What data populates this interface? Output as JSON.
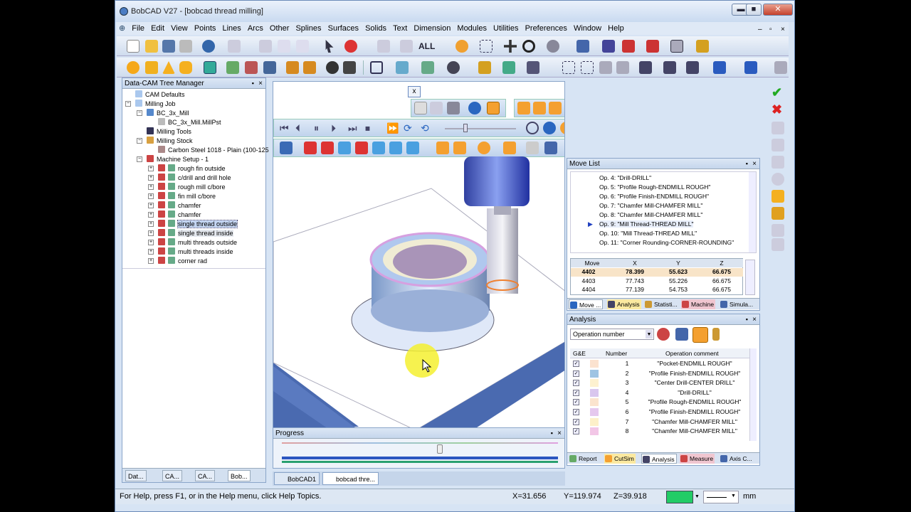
{
  "window": {
    "title": "BobCAD V27 - [bobcad thread milling]",
    "min": "▬",
    "max": "■",
    "close": "✕"
  },
  "menu": {
    "items": [
      "File",
      "Edit",
      "View",
      "Points",
      "Lines",
      "Arcs",
      "Other",
      "Splines",
      "Surfaces",
      "Solids",
      "Text",
      "Dimension",
      "Modules",
      "Utilities",
      "Preferences",
      "Window",
      "Help"
    ],
    "mdi_min": "–",
    "mdi_max": "▫",
    "mdi_close": "×"
  },
  "toolbar": {
    "all_label": "ALL"
  },
  "tree": {
    "title": "Data-CAM Tree Manager",
    "pin": "▪",
    "close": "×",
    "nodes": [
      {
        "label": "CAM Defaults"
      },
      {
        "label": "Milling Job"
      },
      {
        "label": "BC_3x_Mill"
      },
      {
        "label": "BC_3x_Mill.MillPst"
      },
      {
        "label": "Milling Tools"
      },
      {
        "label": "Milling Stock"
      },
      {
        "label": "Carbon Steel 1018 - Plain (100-125"
      },
      {
        "label": "Machine Setup - 1"
      },
      {
        "label": "rough fin outside"
      },
      {
        "label": "c/drill and drill hole"
      },
      {
        "label": "rough mill c/bore"
      },
      {
        "label": "fin mill c/bore"
      },
      {
        "label": "chamfer"
      },
      {
        "label": "chamfer"
      },
      {
        "label": "single thread outside"
      },
      {
        "label": "single thread  inside"
      },
      {
        "label": "multi threads outside"
      },
      {
        "label": "multi threads inside"
      },
      {
        "label": "corner rad"
      }
    ],
    "tabs": [
      "Dat...",
      "CA...",
      "CA...",
      "Bob..."
    ]
  },
  "viewport": {
    "close": "x"
  },
  "progress": {
    "title": "Progress"
  },
  "doctabs": [
    "BobCAD1",
    "bobcad thre..."
  ],
  "movelist": {
    "title": "Move List",
    "ops": [
      "Op. 4: \"Drill-DRILL\"",
      "Op. 5: \"Profile Rough-ENDMILL ROUGH\"",
      "Op. 6: \"Profile Finish-ENDMILL ROUGH\"",
      "Op. 7: \"Chamfer Mill-CHAMFER MILL\"",
      "Op. 8: \"Chamfer Mill-CHAMFER MILL\"",
      "Op. 9: \"Mill Thread-THREAD MILL\"",
      "Op. 10: \"Mill Thread-THREAD MILL\"",
      "Op. 11: \"Corner Rounding-CORNER-ROUNDING\""
    ],
    "headers": [
      "Move",
      "X",
      "Y",
      "Z"
    ],
    "rows": [
      [
        "4402",
        "78.399",
        "55.623",
        "66.675"
      ],
      [
        "4403",
        "77.743",
        "55.226",
        "66.675"
      ],
      [
        "4404",
        "77.139",
        "54.753",
        "66.675"
      ]
    ],
    "tabs": [
      "Move ...",
      "Analysis",
      "Statisti...",
      "Machine",
      "Simula..."
    ]
  },
  "analysis": {
    "title": "Analysis",
    "dropdown": "Operation number",
    "headers": [
      "G&E",
      "Number",
      "Operation comment"
    ],
    "rows": [
      {
        "num": "1",
        "comment": "\"Pocket-ENDMILL ROUGH\"",
        "color": "#fbe2cf"
      },
      {
        "num": "2",
        "comment": "\"Profile Finish-ENDMILL ROUGH\"",
        "color": "#9ec4e3"
      },
      {
        "num": "3",
        "comment": "\"Center Drill-CENTER DRILL\"",
        "color": "#fdf1cf"
      },
      {
        "num": "4",
        "comment": "\"Drill-DRILL\"",
        "color": "#d9c6ee"
      },
      {
        "num": "5",
        "comment": "\"Profile Rough-ENDMILL ROUGH\"",
        "color": "#fbe4ce"
      },
      {
        "num": "6",
        "comment": "\"Profile Finish-ENDMILL ROUGH\"",
        "color": "#e5c8ee"
      },
      {
        "num": "7",
        "comment": "\"Chamfer Mill-CHAMFER MILL\"",
        "color": "#fdf0c9"
      },
      {
        "num": "8",
        "comment": "\"Chamfer Mill-CHAMFER MILL\"",
        "color": "#f2c6e6"
      }
    ],
    "tabs": [
      "Report",
      "CutSim",
      "Analysis",
      "Measure",
      "Axis C..."
    ]
  },
  "status": {
    "help": "For Help, press F1, or in the Help menu, click Help Topics.",
    "x": "X=31.656",
    "y": "Y=119.974",
    "z": "Z=39.918",
    "unit": "mm",
    "color": "#22cc66"
  }
}
